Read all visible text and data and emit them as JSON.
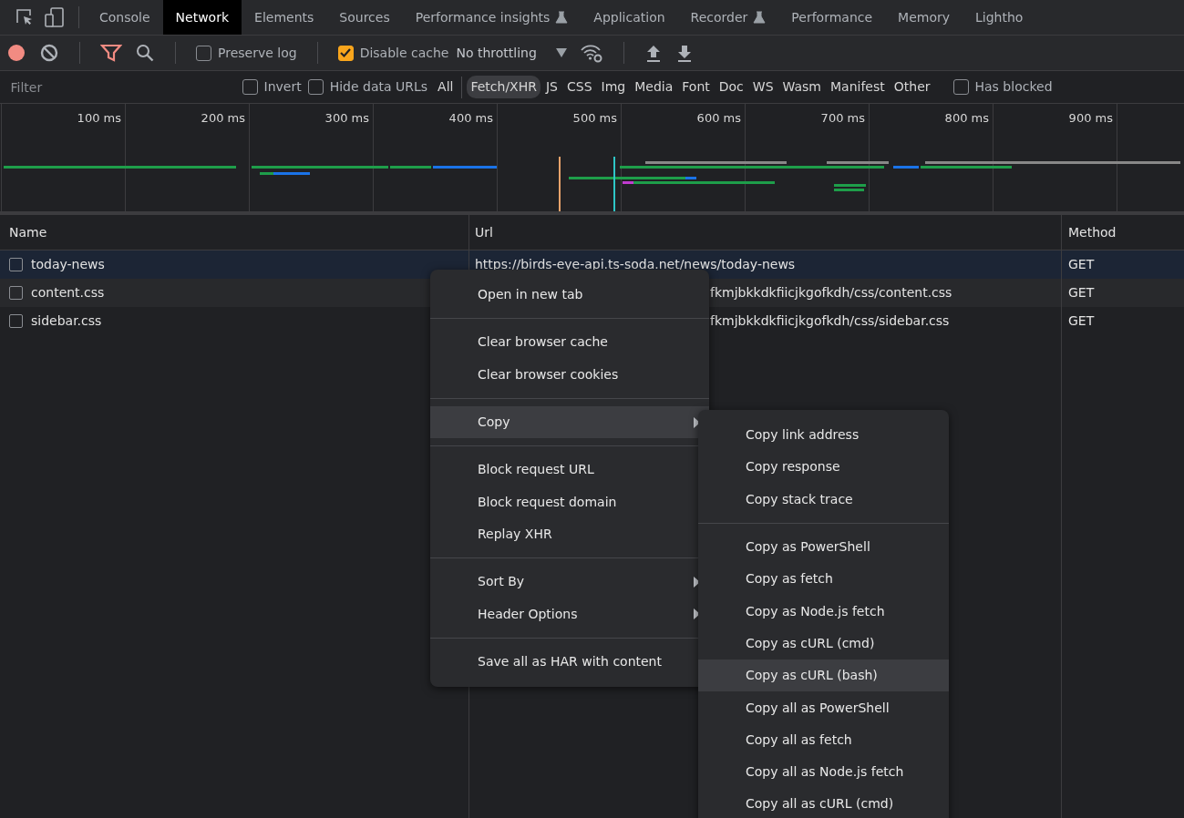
{
  "panel_tabs": [
    {
      "label": "Console",
      "selected": false,
      "experimental": false
    },
    {
      "label": "Network",
      "selected": true,
      "experimental": false
    },
    {
      "label": "Elements",
      "selected": false,
      "experimental": false
    },
    {
      "label": "Sources",
      "selected": false,
      "experimental": false
    },
    {
      "label": "Performance insights",
      "selected": false,
      "experimental": true
    },
    {
      "label": "Application",
      "selected": false,
      "experimental": false
    },
    {
      "label": "Recorder",
      "selected": false,
      "experimental": true
    },
    {
      "label": "Performance",
      "selected": false,
      "experimental": false
    },
    {
      "label": "Memory",
      "selected": false,
      "experimental": false
    },
    {
      "label": "Lightho",
      "selected": false,
      "experimental": false
    }
  ],
  "toolbar": {
    "preserve_log": {
      "label": "Preserve log",
      "checked": false
    },
    "disable_cache": {
      "label": "Disable cache",
      "checked": true
    },
    "throttling": "No throttling"
  },
  "filter": {
    "placeholder": "Filter",
    "invert": {
      "label": "Invert",
      "checked": false
    },
    "hide_data_urls": {
      "label": "Hide data URLs",
      "checked": false
    },
    "types": [
      {
        "label": "All",
        "selected": false
      },
      {
        "label": "Fetch/XHR",
        "selected": true
      },
      {
        "label": "JS",
        "selected": false
      },
      {
        "label": "CSS",
        "selected": false
      },
      {
        "label": "Img",
        "selected": false
      },
      {
        "label": "Media",
        "selected": false
      },
      {
        "label": "Font",
        "selected": false
      },
      {
        "label": "Doc",
        "selected": false
      },
      {
        "label": "WS",
        "selected": false
      },
      {
        "label": "Wasm",
        "selected": false
      },
      {
        "label": "Manifest",
        "selected": false
      },
      {
        "label": "Other",
        "selected": false
      }
    ],
    "has_blocked": {
      "label": "Has blocked",
      "checked": false
    }
  },
  "timeline": {
    "ticks": [
      "100 ms",
      "200 ms",
      "300 ms",
      "400 ms",
      "500 ms",
      "600 ms",
      "700 ms",
      "800 ms",
      "900 ms"
    ]
  },
  "table": {
    "columns": [
      "Name",
      "Url",
      "Method"
    ],
    "rows": [
      {
        "name": "today-news",
        "url": "https://birds-eye-api.ts-soda.net/news/today-news",
        "method": "GET",
        "selected": true,
        "url_covered": false
      },
      {
        "name": "content.css",
        "url": "fkmjbkkdkfiicjkgofkdh/css/content.css",
        "method": "GET",
        "selected": false,
        "url_covered": true
      },
      {
        "name": "sidebar.css",
        "url": "fkmjbkkdkfiicjkgofkdh/css/sidebar.css",
        "method": "GET",
        "selected": false,
        "url_covered": true
      }
    ]
  },
  "context_menu": {
    "groups": [
      [
        {
          "label": "Open in new tab",
          "submenu": false,
          "selected": false
        }
      ],
      [
        {
          "label": "Clear browser cache",
          "submenu": false,
          "selected": false
        },
        {
          "label": "Clear browser cookies",
          "submenu": false,
          "selected": false
        }
      ],
      [
        {
          "label": "Copy",
          "submenu": true,
          "selected": true
        }
      ],
      [
        {
          "label": "Block request URL",
          "submenu": false,
          "selected": false
        },
        {
          "label": "Block request domain",
          "submenu": false,
          "selected": false
        },
        {
          "label": "Replay XHR",
          "submenu": false,
          "selected": false
        }
      ],
      [
        {
          "label": "Sort By",
          "submenu": true,
          "selected": false
        },
        {
          "label": "Header Options",
          "submenu": true,
          "selected": false
        }
      ],
      [
        {
          "label": "Save all as HAR with content",
          "submenu": false,
          "selected": false
        }
      ]
    ]
  },
  "copy_submenu": {
    "groups": [
      [
        {
          "label": "Copy link address",
          "selected": false
        },
        {
          "label": "Copy response",
          "selected": false
        },
        {
          "label": "Copy stack trace",
          "selected": false
        }
      ],
      [
        {
          "label": "Copy as PowerShell",
          "selected": false
        },
        {
          "label": "Copy as fetch",
          "selected": false
        },
        {
          "label": "Copy as Node.js fetch",
          "selected": false
        },
        {
          "label": "Copy as cURL (cmd)",
          "selected": false
        },
        {
          "label": "Copy as cURL (bash)",
          "selected": true
        },
        {
          "label": "Copy all as PowerShell",
          "selected": false
        },
        {
          "label": "Copy all as fetch",
          "selected": false
        },
        {
          "label": "Copy all as Node.js fetch",
          "selected": false
        },
        {
          "label": "Copy all as cURL (cmd)",
          "selected": false
        }
      ]
    ]
  }
}
